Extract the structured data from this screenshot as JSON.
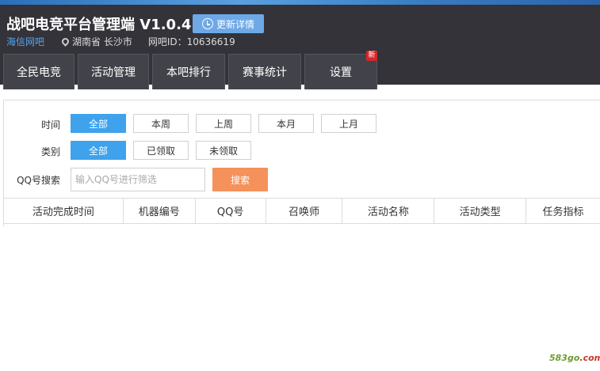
{
  "app": {
    "title": "战吧电竞平台管理端 V1.0.4.4",
    "update_label": "更新详情",
    "isp": "海信网吧",
    "location": "湖南省 长沙市",
    "netbar_id": "网吧ID：10636619"
  },
  "tabs": [
    {
      "label": "全民电竞"
    },
    {
      "label": "活动管理"
    },
    {
      "label": "本吧排行"
    },
    {
      "label": "赛事统计"
    },
    {
      "label": "设置",
      "badge": "新"
    }
  ],
  "filters": {
    "time_label": "时间",
    "time_options": [
      "全部",
      "本周",
      "上周",
      "本月",
      "上月"
    ],
    "time_selected": "全部",
    "category_label": "类别",
    "category_options": [
      "全部",
      "已领取",
      "未领取"
    ],
    "category_selected": "全部",
    "qq_label": "QQ号搜索",
    "qq_placeholder": "输入QQ号进行筛选",
    "search_label": "搜索"
  },
  "table": {
    "columns": [
      "活动完成时间",
      "机器编号",
      "QQ号",
      "召唤师",
      "活动名称",
      "活动类型",
      "任务指标"
    ]
  },
  "watermark": {
    "a": "583go",
    "b": ".com"
  },
  "colors": {
    "accent": "#3ea2ec",
    "search": "#f5915a",
    "header": "#333339",
    "isp": "#5ba3e6",
    "badge": "#d4272b"
  }
}
